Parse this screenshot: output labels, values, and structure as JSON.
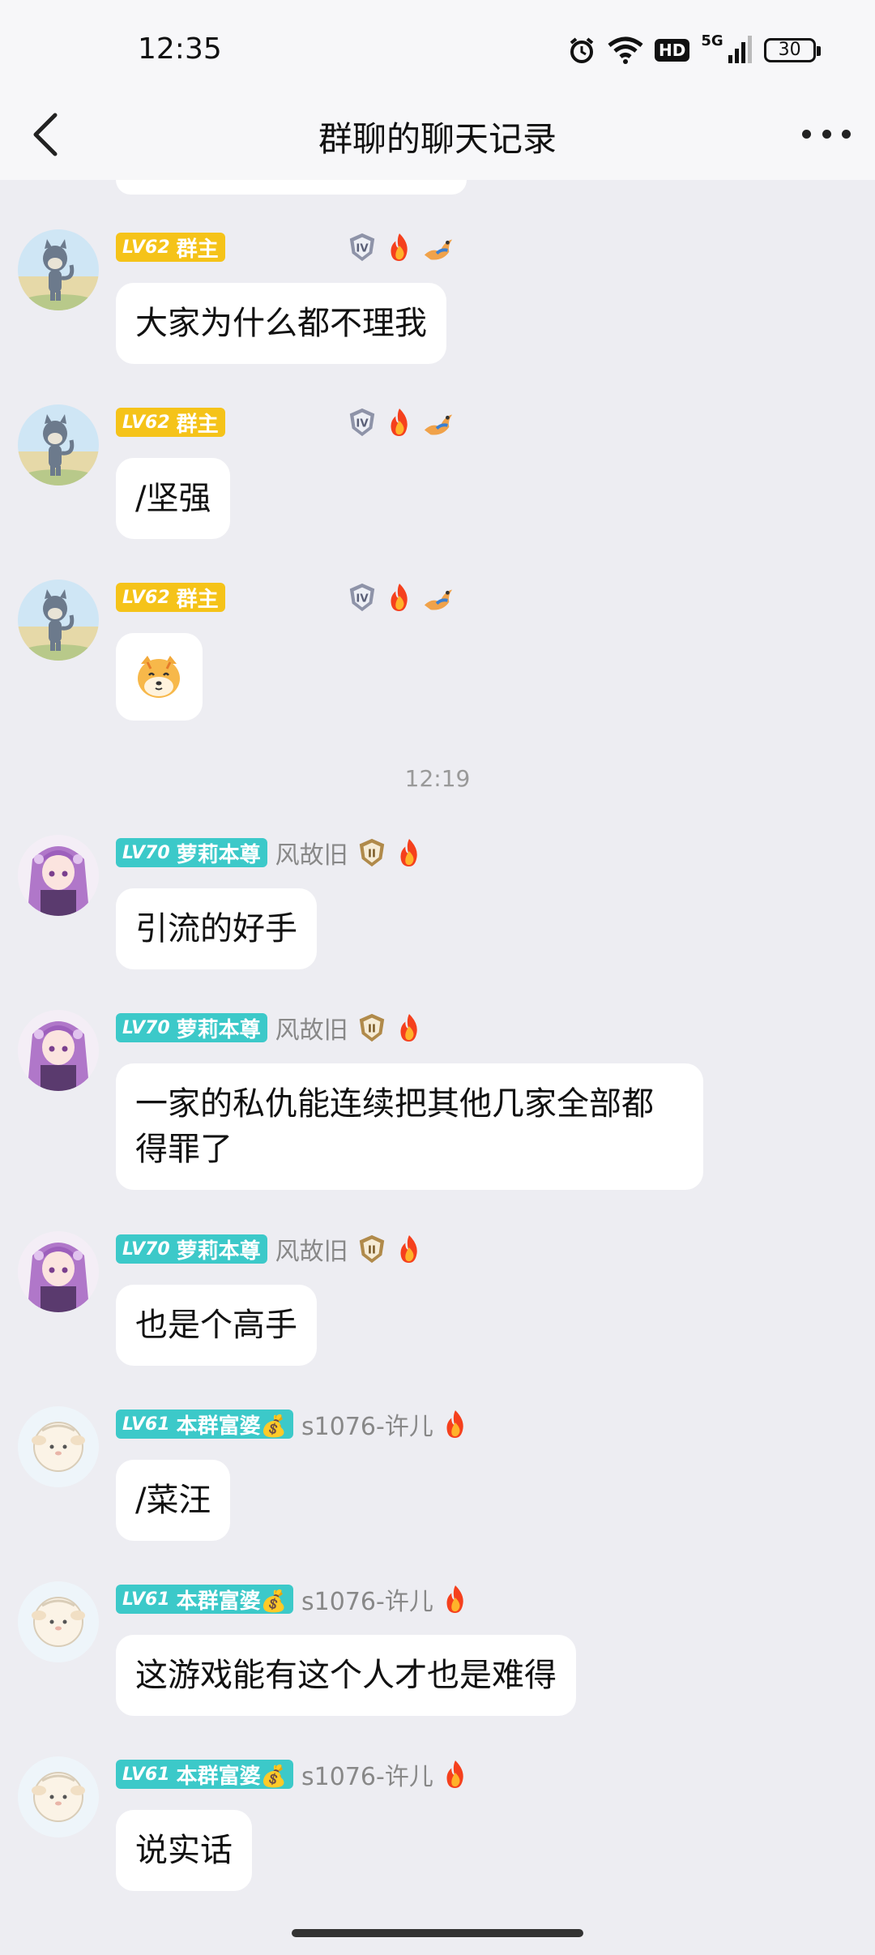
{
  "status": {
    "time": "12:35",
    "battery": "30",
    "hd": "HD",
    "network": "5G"
  },
  "nav": {
    "title": "群聊的聊天记录"
  },
  "colors": {
    "owner_badge": "#f5c319",
    "member_badge": "#3cc9c9"
  },
  "timestamp": "12:19",
  "messages": [
    {
      "level": "LV62",
      "role": "群主",
      "nick": "",
      "text": "大家为什么都不理我",
      "avatar": "tom-cat-avatar",
      "honors": [
        "tier-iv-badge-icon",
        "fire-icon",
        "dragon-icon"
      ]
    },
    {
      "level": "LV62",
      "role": "群主",
      "nick": "",
      "text": "/坚强",
      "avatar": "tom-cat-avatar",
      "honors": [
        "tier-iv-badge-icon",
        "fire-icon",
        "dragon-icon"
      ]
    },
    {
      "level": "LV62",
      "role": "群主",
      "nick": "",
      "text": "",
      "avatar": "tom-cat-avatar",
      "honors": [
        "tier-iv-badge-icon",
        "fire-icon",
        "dragon-icon"
      ],
      "sticker": "dog-face-emoji"
    },
    {
      "level": "LV70",
      "role": "萝莉本尊",
      "nick": "风故旧",
      "text": "引流的好手",
      "avatar": "anime-girl-avatar",
      "honors": [
        "tier-ii-badge-icon",
        "fire-icon"
      ]
    },
    {
      "level": "LV70",
      "role": "萝莉本尊",
      "nick": "风故旧",
      "text": "一家的私仇能连续把其他几家全部都得罪了",
      "avatar": "anime-girl-avatar",
      "honors": [
        "tier-ii-badge-icon",
        "fire-icon"
      ]
    },
    {
      "level": "LV70",
      "role": "萝莉本尊",
      "nick": "风故旧",
      "text": "也是个高手",
      "avatar": "anime-girl-avatar",
      "honors": [
        "tier-ii-badge-icon",
        "fire-icon"
      ]
    },
    {
      "level": "LV61",
      "role": "本群富婆💰",
      "nick": "s1076-许儿",
      "text": "/菜汪",
      "avatar": "sheep-avatar",
      "honors": [
        "fire-icon"
      ]
    },
    {
      "level": "LV61",
      "role": "本群富婆💰",
      "nick": "s1076-许儿",
      "text": "这游戏能有这个人才也是难得",
      "avatar": "sheep-avatar",
      "honors": [
        "fire-icon"
      ]
    },
    {
      "level": "LV61",
      "role": "本群富婆💰",
      "nick": "s1076-许儿",
      "text": "说实话",
      "avatar": "sheep-avatar",
      "honors": [
        "fire-icon"
      ]
    }
  ]
}
